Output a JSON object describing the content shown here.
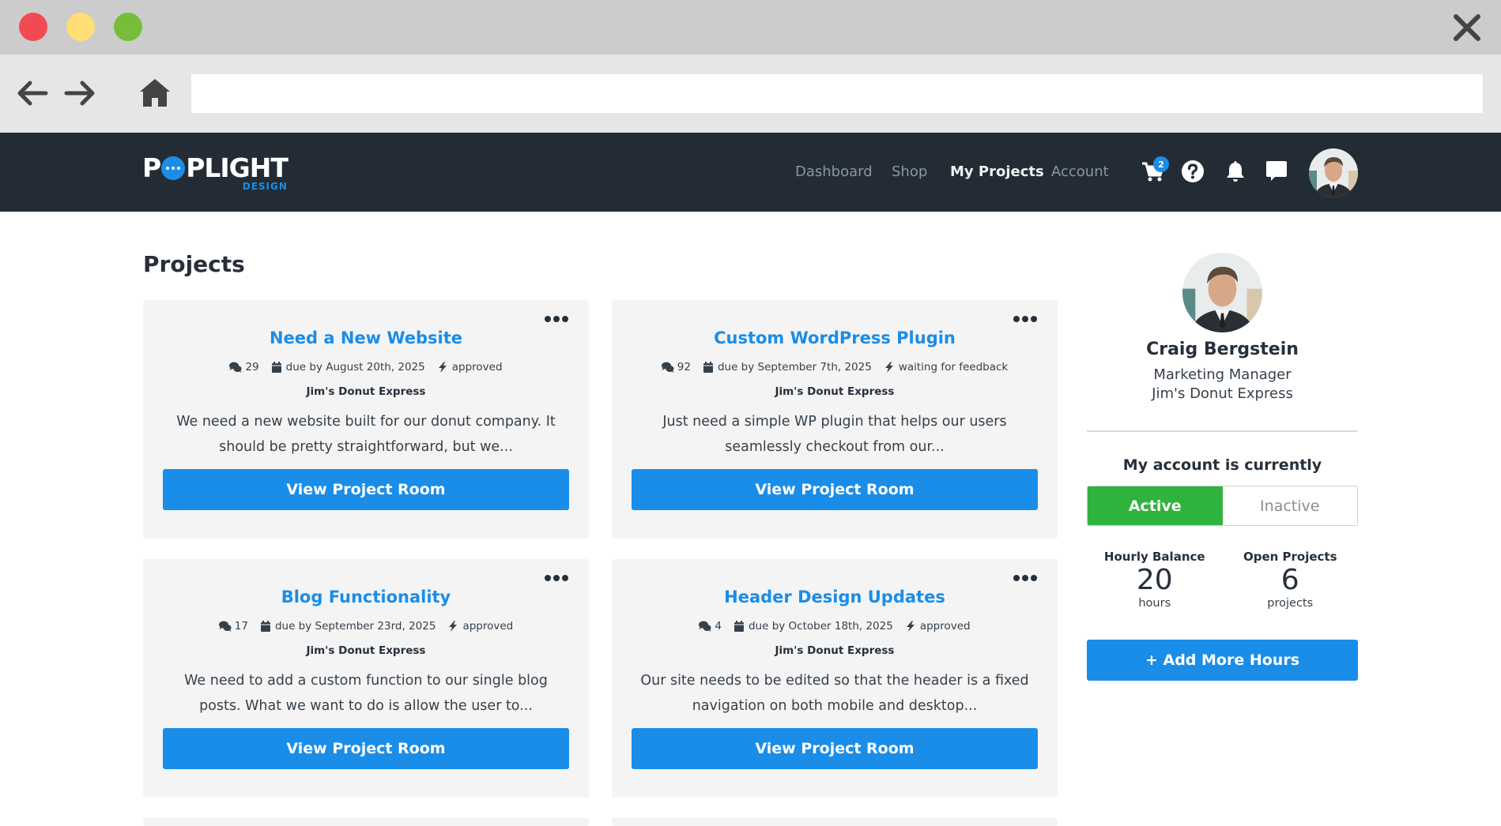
{
  "browser": {
    "address_value": "",
    "buttons": {
      "back": "back-arrow-icon",
      "forward": "forward-arrow-icon",
      "home": "home-icon",
      "close": "close-icon"
    }
  },
  "header": {
    "logo": {
      "main_left": "P",
      "main_right": "PLIGHT",
      "sub": "DESIGN"
    },
    "nav": [
      {
        "label": "Dashboard",
        "active": false
      },
      {
        "label": "Shop",
        "active": false
      },
      {
        "label": "My Projects",
        "active": true
      },
      {
        "label": "Account",
        "active": false
      }
    ],
    "cart_count": "2",
    "icons": [
      "cart-icon",
      "help-icon",
      "bell-icon",
      "chat-icon"
    ]
  },
  "main": {
    "title": "Projects",
    "projects": [
      {
        "title": "Need a New Website",
        "comments": "29",
        "due": "due by August 20th, 2025",
        "status": "approved",
        "client": "Jim's Donut Express",
        "description": "We need a new website built for our donut company. It should be pretty straightforward, but we...",
        "button": "View Project Room"
      },
      {
        "title": "Custom WordPress Plugin",
        "comments": "92",
        "due": "due by September 7th, 2025",
        "status": "waiting for feedback",
        "client": "Jim's Donut Express",
        "description": "Just need a simple WP plugin that helps our users seamlessly checkout from our...",
        "button": "View Project Room"
      },
      {
        "title": "Blog Functionality",
        "comments": "17",
        "due": "due by September 23rd, 2025",
        "status": "approved",
        "client": "Jim's Donut Express",
        "description": "We need to add a custom function to our single blog posts. What we want to do is allow the user to...",
        "button": "View Project Room"
      },
      {
        "title": "Header Design Updates",
        "comments": "4",
        "due": "due by October 18th, 2025",
        "status": "approved",
        "client": "Jim's Donut Express",
        "description": "Our site needs to be edited so that the header is a fixed navigation on both mobile and desktop...",
        "button": "View Project Room"
      }
    ]
  },
  "sidebar": {
    "name": "Craig Bergstein",
    "role": "Marketing Manager",
    "company": "Jim's Donut Express",
    "status_label": "My account is currently",
    "toggle": {
      "active": "Active",
      "inactive": "Inactive",
      "selected": "Active"
    },
    "stats": [
      {
        "label": "Hourly Balance",
        "value": "20",
        "unit": "hours"
      },
      {
        "label": "Open Projects",
        "value": "6",
        "unit": "projects"
      }
    ],
    "add_hours_button": "+ Add More Hours"
  },
  "colors": {
    "accent": "#1a8de8",
    "active_green": "#2eb43e",
    "header_bg": "#232c34",
    "card_bg": "#f4f4f4"
  }
}
